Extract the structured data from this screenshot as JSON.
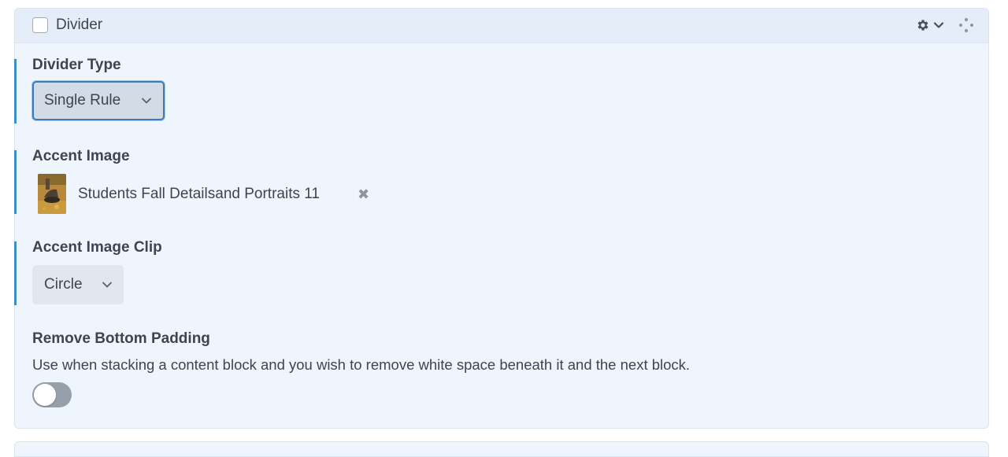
{
  "block": {
    "title": "Divider",
    "actions": {
      "settings_icon": "gear-icon",
      "expand_icon": "chevron-down-icon",
      "drag_icon": "drag-handle-icon"
    }
  },
  "fields": {
    "divider_type": {
      "label": "Divider Type",
      "selected": "Single Rule"
    },
    "accent_image": {
      "label": "Accent Image",
      "file_name": "Students Fall Detailsand Portraits 11",
      "remove_glyph": "✖"
    },
    "accent_image_clip": {
      "label": "Accent Image Clip",
      "selected": "Circle"
    },
    "remove_bottom_padding": {
      "label": "Remove Bottom Padding",
      "description": "Use when stacking a content block and you wish to remove white space beneath it and the next block.",
      "enabled": false
    }
  },
  "colors": {
    "accent_bar": "#3b8fc4",
    "panel_bg": "#eef5fc",
    "toggle_off": "#96a0ab"
  }
}
